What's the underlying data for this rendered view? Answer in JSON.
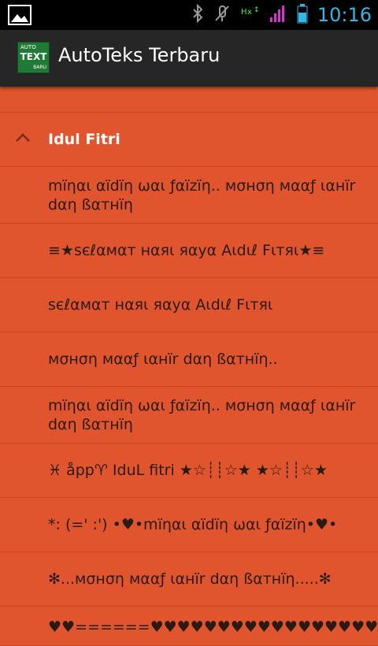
{
  "status_bar": {
    "time": "10:16",
    "icons": [
      "image-icon",
      "bluetooth-icon",
      "mute-icon",
      "hx-data-icon",
      "signal-icon",
      "battery-icon"
    ],
    "accent_color": "#33b5e5"
  },
  "action_bar": {
    "title": "AutoTeks Terbaru",
    "icon": {
      "line1": "AUTO",
      "line2": "TEXT",
      "line3": "BARU"
    }
  },
  "list": {
    "group": {
      "label": "Idul Fitri",
      "expanded": true
    },
    "items": [
      "mïηαι αïdïη ωαι ƒαïzïη.. мσнση мααƒ ιαнïr dαη ßαтнïη",
      "≡★ѕєℓαмαт нαяι яαуα Αιdιℓ Fιтяι★≡",
      "ѕєℓαмαт нαяι яαуα Αιdιℓ Fιтяι",
      "мσнση мααƒ ιαнïr dαη ßαтнïη..",
      "mïηαι αïdïη ωαι ƒαïzïη.. мσнση мααƒ ιαнïr dαη ßαтнïη",
      "♓ åpp♈ IduL fitri ★☆┊┊☆★ ★☆┊┊☆★",
      "*: (=' :') •♥•mïηαι αïdïη ωαι ƒαïzïη•♥•",
      "✻...мσнση мααƒ ιαнïr dαη ßαтнïη.....✻",
      "♥♥======♥♥♥♥♥♥♥♥♥♥♥♥♥♥♥♥♥"
    ]
  },
  "colors": {
    "background": "#e0552e",
    "divider": "#c2461f",
    "action_bar": "#262626"
  }
}
